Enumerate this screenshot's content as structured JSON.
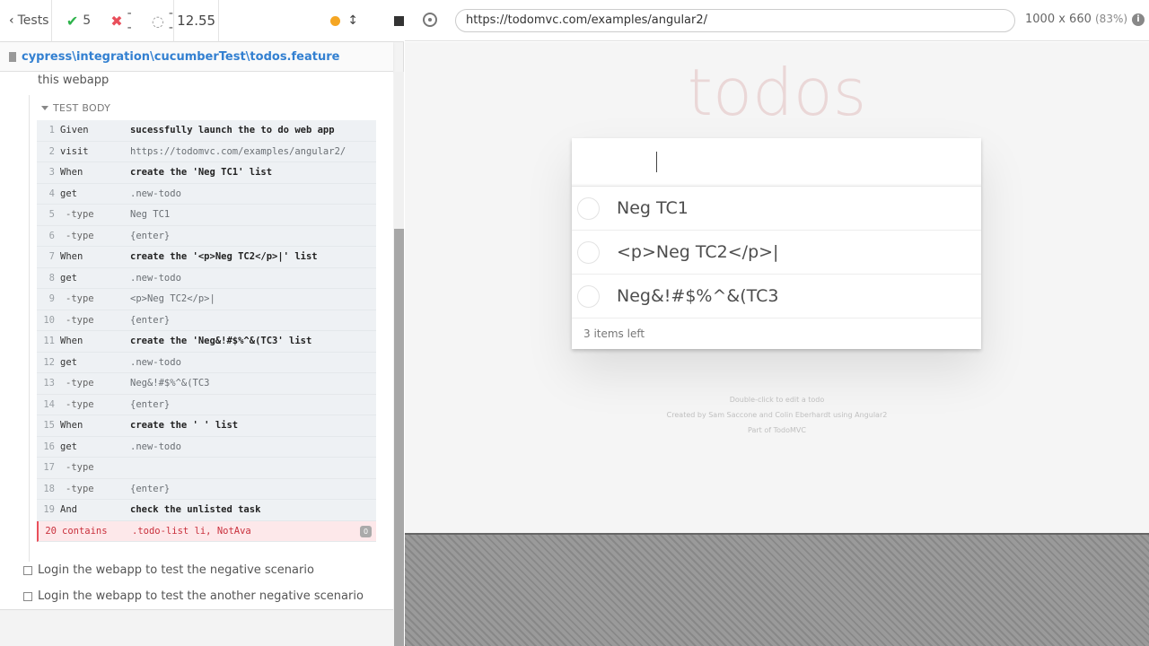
{
  "reporter": {
    "tests_label": "Tests",
    "passed_count": "5",
    "failed_count": "--",
    "pending_count": "--",
    "duration": "12.55",
    "file_path": "cypress\\integration\\cucumberTest\\todos.feature",
    "suite_title": "this webapp",
    "test_body_label": "TEST BODY",
    "commands": [
      {
        "num": "1",
        "name": "Given",
        "message": "sucessfully launch the to do web app",
        "kind": "step"
      },
      {
        "num": "2",
        "name": "visit",
        "message": "https://todomvc.com/examples/angular2/",
        "kind": "cmd"
      },
      {
        "num": "3",
        "name": "When",
        "message": "create the 'Neg TC1' list",
        "kind": "step"
      },
      {
        "num": "4",
        "name": "get",
        "message": ".new-todo",
        "kind": "cmd"
      },
      {
        "num": "5",
        "name": "-type",
        "message": "Neg TC1",
        "kind": "sub"
      },
      {
        "num": "6",
        "name": "-type",
        "message": "{enter}",
        "kind": "sub"
      },
      {
        "num": "7",
        "name": "When",
        "message": "create the '<p>Neg TC2</p>|' list",
        "kind": "step"
      },
      {
        "num": "8",
        "name": "get",
        "message": ".new-todo",
        "kind": "cmd"
      },
      {
        "num": "9",
        "name": "-type",
        "message": "<p>Neg TC2</p>|",
        "kind": "sub"
      },
      {
        "num": "10",
        "name": "-type",
        "message": "{enter}",
        "kind": "sub"
      },
      {
        "num": "11",
        "name": "When",
        "message": "create the 'Neg&!#$%^&(TC3' list",
        "kind": "step"
      },
      {
        "num": "12",
        "name": "get",
        "message": ".new-todo",
        "kind": "cmd"
      },
      {
        "num": "13",
        "name": "-type",
        "message": "Neg&!#$%^&(TC3",
        "kind": "sub"
      },
      {
        "num": "14",
        "name": "-type",
        "message": "{enter}",
        "kind": "sub"
      },
      {
        "num": "15",
        "name": "When",
        "message": "create the ' ' list",
        "kind": "step"
      },
      {
        "num": "16",
        "name": "get",
        "message": ".new-todo",
        "kind": "cmd"
      },
      {
        "num": "17",
        "name": "-type",
        "message": "",
        "kind": "sub"
      },
      {
        "num": "18",
        "name": "-type",
        "message": "{enter}",
        "kind": "sub"
      },
      {
        "num": "19",
        "name": "And",
        "message": "check the unlisted task",
        "kind": "step"
      },
      {
        "num": "20",
        "name": "contains",
        "message": ".todo-list li, NotAva",
        "kind": "failed",
        "badge": "0"
      }
    ],
    "other_tests": [
      "Login the webapp to test the negative scenario",
      "Login the webapp to test the another negative scenario"
    ]
  },
  "aut": {
    "url": "https://todomvc.com/examples/angular2/",
    "viewport_size": "1000 x 660",
    "viewport_scale": "(83%)",
    "app_title": "todos",
    "todos": [
      "Neg TC1",
      "<p>Neg TC2</p>|",
      "Neg&!#$%^&(TC3"
    ],
    "items_left": "3 items left",
    "info_lines": [
      "Double-click to edit a todo",
      "Created by Sam Saccone and Colin Eberhardt using Angular2",
      "Part of TodoMVC"
    ]
  },
  "colors": {
    "pass": "#2eb34b",
    "fail": "#e94f5b",
    "link": "#3380d1",
    "running_dot": "#f5a623"
  }
}
